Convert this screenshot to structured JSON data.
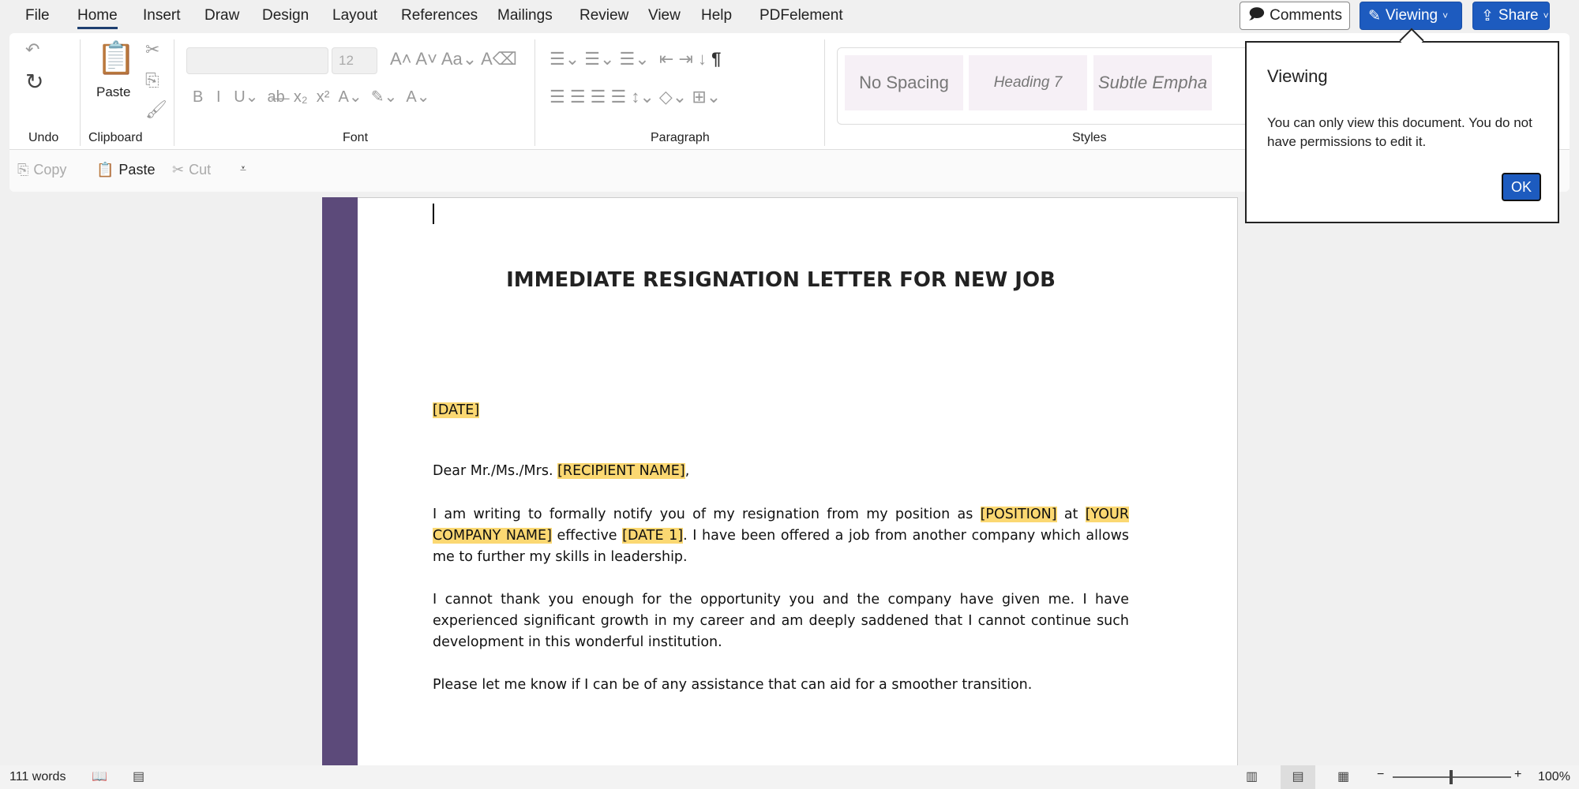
{
  "menu": {
    "tabs": [
      "File",
      "Home",
      "Insert",
      "Draw",
      "Design",
      "Layout",
      "References",
      "Mailings",
      "Review",
      "View",
      "Help",
      "PDFelement"
    ],
    "active": "Home"
  },
  "header": {
    "comments": "Comments",
    "viewing": "Viewing",
    "share": "Share"
  },
  "ribbon": {
    "groups": {
      "undo": "Undo",
      "clipboard": "Clipboard",
      "font": "Font",
      "paragraph": "Paragraph",
      "styles": "Styles"
    },
    "paste_label": "Paste",
    "font_size": "12",
    "styles": [
      "No Spacing",
      "Heading 7",
      "Subtle Empha"
    ]
  },
  "quickbar": {
    "copy": "Copy",
    "paste": "Paste",
    "cut": "Cut"
  },
  "popup": {
    "title": "Viewing",
    "message": "You can only view this document. You do not have permissions to edit it.",
    "ok": "OK"
  },
  "document": {
    "title": "IMMEDIATE RESIGNATION LETTER FOR NEW JOB",
    "date": "[DATE]",
    "salutation_pre": "Dear Mr./Ms./Mrs. ",
    "recipient": "[RECIPIENT NAME]",
    "salutation_post": ",",
    "p1_a": "I am writing to formally notify you of my resignation from my position as ",
    "position": "[POSITION]",
    "p1_b": " at ",
    "company": "[YOUR COMPANY NAME]",
    "p1_c": " effective ",
    "date1": "[DATE 1]",
    "p1_d": ". I have been offered a job from another company which allows me to further my skills in leadership.",
    "p2": "I cannot thank you enough for the opportunity you and the company have given me. I have experienced significant growth in my career and am deeply saddened that I cannot continue such development in this wonderful institution.",
    "p3": "Please let me know if I can be of any assistance that can aid for a smoother transition."
  },
  "status": {
    "words": "111 words",
    "zoom": "100%",
    "zoom_level_percent": 100
  },
  "colors": {
    "accent": "#1d5bbf",
    "sidebar": "#5c4a7a",
    "highlight": "#fbd872"
  }
}
